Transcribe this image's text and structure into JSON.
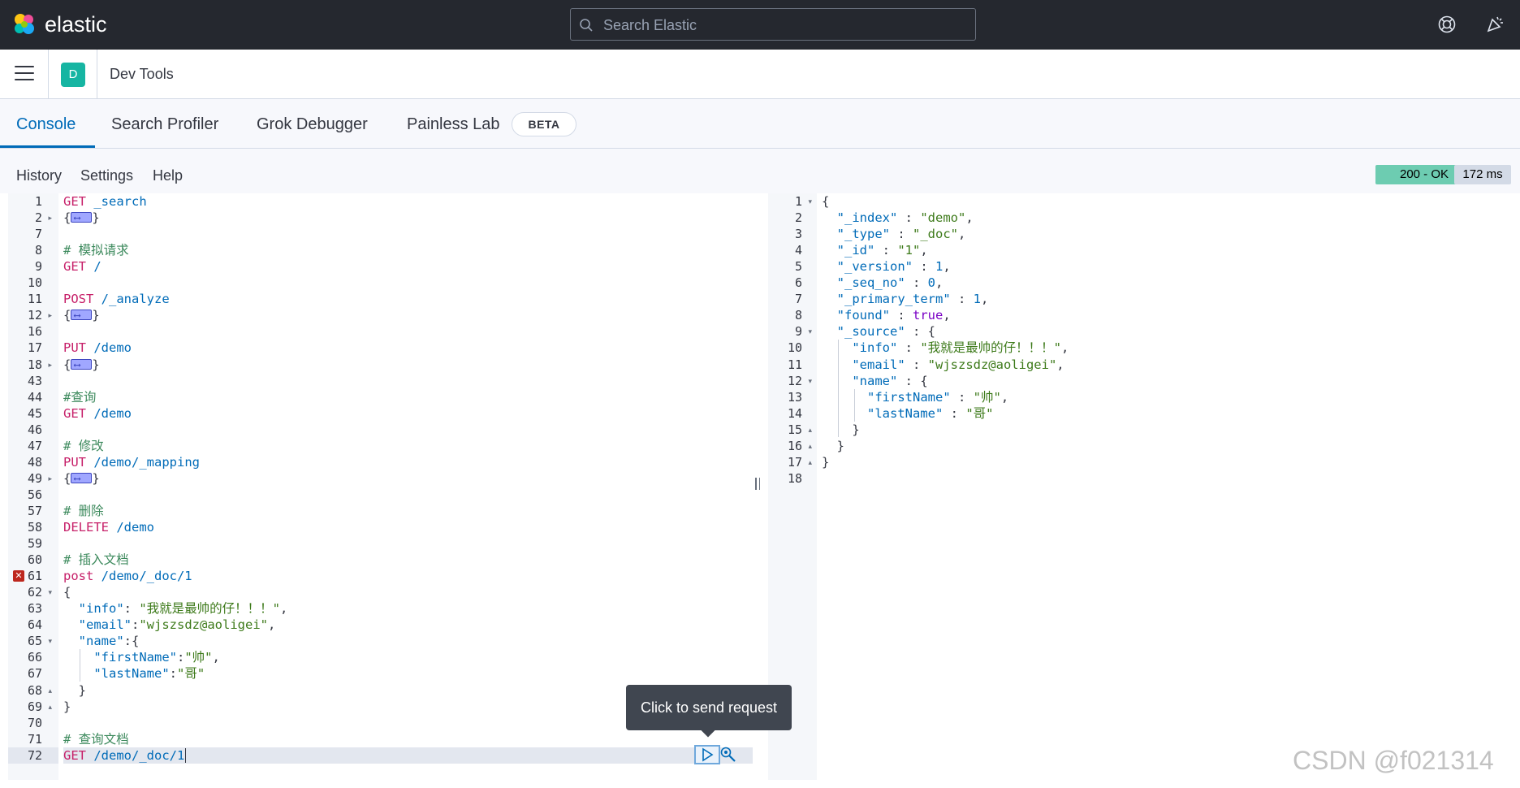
{
  "header": {
    "brand": "elastic",
    "search_placeholder": "Search Elastic"
  },
  "breadcrumb": {
    "space_initial": "D",
    "title": "Dev Tools"
  },
  "tabs": [
    {
      "label": "Console",
      "active": true
    },
    {
      "label": "Search Profiler",
      "active": false
    },
    {
      "label": "Grok Debugger",
      "active": false
    },
    {
      "label": "Painless Lab",
      "active": false
    }
  ],
  "beta_badge": "BETA",
  "toolbar": {
    "history": "History",
    "settings": "Settings",
    "help": "Help",
    "status": "200 - OK",
    "duration": "172 ms"
  },
  "request_editor": {
    "lines": [
      {
        "n": "1",
        "segments": [
          [
            "m",
            "GET"
          ],
          [
            "u",
            " _search"
          ]
        ]
      },
      {
        "n": "2",
        "fold": "closed",
        "segments": [
          [
            "p",
            "{"
          ],
          [
            "w",
            ""
          ],
          [
            "p",
            "}"
          ]
        ]
      },
      {
        "n": "7",
        "segments": []
      },
      {
        "n": "8",
        "segments": [
          [
            "c",
            "# 模拟请求"
          ]
        ]
      },
      {
        "n": "9",
        "segments": [
          [
            "m",
            "GET"
          ],
          [
            "u",
            " /"
          ]
        ]
      },
      {
        "n": "10",
        "segments": []
      },
      {
        "n": "11",
        "segments": [
          [
            "m",
            "POST"
          ],
          [
            "u",
            " /_analyze"
          ]
        ]
      },
      {
        "n": "12",
        "fold": "closed",
        "segments": [
          [
            "p",
            "{"
          ],
          [
            "w",
            ""
          ],
          [
            "p",
            "}"
          ]
        ]
      },
      {
        "n": "16",
        "segments": []
      },
      {
        "n": "17",
        "segments": [
          [
            "m",
            "PUT"
          ],
          [
            "u",
            " /demo"
          ]
        ]
      },
      {
        "n": "18",
        "fold": "closed",
        "segments": [
          [
            "p",
            "{"
          ],
          [
            "w",
            ""
          ],
          [
            "p",
            "}"
          ]
        ]
      },
      {
        "n": "43",
        "segments": []
      },
      {
        "n": "44",
        "segments": [
          [
            "c",
            "#查询"
          ]
        ]
      },
      {
        "n": "45",
        "segments": [
          [
            "m",
            "GET"
          ],
          [
            "u",
            " /demo"
          ]
        ]
      },
      {
        "n": "46",
        "segments": []
      },
      {
        "n": "47",
        "segments": [
          [
            "c",
            "# 修改"
          ]
        ]
      },
      {
        "n": "48",
        "segments": [
          [
            "m",
            "PUT"
          ],
          [
            "u",
            " /demo/_mapping"
          ]
        ]
      },
      {
        "n": "49",
        "fold": "closed",
        "segments": [
          [
            "p",
            "{"
          ],
          [
            "w",
            ""
          ],
          [
            "p",
            "}"
          ]
        ]
      },
      {
        "n": "56",
        "segments": []
      },
      {
        "n": "57",
        "segments": [
          [
            "c",
            "# 删除"
          ]
        ]
      },
      {
        "n": "58",
        "segments": [
          [
            "m",
            "DELETE"
          ],
          [
            "u",
            " /demo"
          ]
        ]
      },
      {
        "n": "59",
        "segments": []
      },
      {
        "n": "60",
        "segments": [
          [
            "c",
            "# 插入文档"
          ]
        ]
      },
      {
        "n": "61",
        "error": true,
        "segments": [
          [
            "m",
            "post"
          ],
          [
            "u",
            " /demo/_doc/1"
          ]
        ]
      },
      {
        "n": "62",
        "fold": "open",
        "segments": [
          [
            "p",
            "{"
          ]
        ]
      },
      {
        "n": "63",
        "segments": [
          [
            "p",
            "  "
          ],
          [
            "k",
            "\"info\""
          ],
          [
            "p",
            ": "
          ],
          [
            "s",
            "\"我就是最帅的仔！！！\""
          ],
          [
            "p",
            ","
          ]
        ]
      },
      {
        "n": "64",
        "segments": [
          [
            "p",
            "  "
          ],
          [
            "k",
            "\"email\""
          ],
          [
            "p",
            ":"
          ],
          [
            "s",
            "\"wjszsdz@aoligei\""
          ],
          [
            "p",
            ","
          ]
        ]
      },
      {
        "n": "65",
        "fold": "open",
        "segments": [
          [
            "p",
            "  "
          ],
          [
            "k",
            "\"name\""
          ],
          [
            "p",
            ":{"
          ]
        ]
      },
      {
        "n": "66",
        "segments": [
          [
            "p",
            "    "
          ],
          [
            "k",
            "\"firstName\""
          ],
          [
            "p",
            ":"
          ],
          [
            "s",
            "\"帅\""
          ],
          [
            "p",
            ","
          ]
        ]
      },
      {
        "n": "67",
        "segments": [
          [
            "p",
            "    "
          ],
          [
            "k",
            "\"lastName\""
          ],
          [
            "p",
            ":"
          ],
          [
            "s",
            "\"哥\""
          ]
        ]
      },
      {
        "n": "68",
        "fold": "end",
        "segments": [
          [
            "p",
            "  }"
          ]
        ]
      },
      {
        "n": "69",
        "fold": "end",
        "segments": [
          [
            "p",
            "}"
          ]
        ]
      },
      {
        "n": "70",
        "segments": []
      },
      {
        "n": "71",
        "segments": [
          [
            "c",
            "# 查询文档"
          ]
        ]
      },
      {
        "n": "72",
        "active": true,
        "segments": [
          [
            "m",
            "GET"
          ],
          [
            "u",
            " /demo/_doc/1"
          ]
        ]
      }
    ]
  },
  "response_editor": {
    "lines": [
      {
        "n": "1",
        "fold": "open",
        "segments": [
          [
            "p",
            "{"
          ]
        ]
      },
      {
        "n": "2",
        "segments": [
          [
            "p",
            "  "
          ],
          [
            "k",
            "\"_index\""
          ],
          [
            "p",
            " : "
          ],
          [
            "s",
            "\"demo\""
          ],
          [
            "p",
            ","
          ]
        ]
      },
      {
        "n": "3",
        "segments": [
          [
            "p",
            "  "
          ],
          [
            "k",
            "\"_type\""
          ],
          [
            "p",
            " : "
          ],
          [
            "s",
            "\"_doc\""
          ],
          [
            "p",
            ","
          ]
        ]
      },
      {
        "n": "4",
        "segments": [
          [
            "p",
            "  "
          ],
          [
            "k",
            "\"_id\""
          ],
          [
            "p",
            " : "
          ],
          [
            "s",
            "\"1\""
          ],
          [
            "p",
            ","
          ]
        ]
      },
      {
        "n": "5",
        "segments": [
          [
            "p",
            "  "
          ],
          [
            "k",
            "\"_version\""
          ],
          [
            "p",
            " : "
          ],
          [
            "n",
            "1"
          ],
          [
            "p",
            ","
          ]
        ]
      },
      {
        "n": "6",
        "segments": [
          [
            "p",
            "  "
          ],
          [
            "k",
            "\"_seq_no\""
          ],
          [
            "p",
            " : "
          ],
          [
            "n",
            "0"
          ],
          [
            "p",
            ","
          ]
        ]
      },
      {
        "n": "7",
        "segments": [
          [
            "p",
            "  "
          ],
          [
            "k",
            "\"_primary_term\""
          ],
          [
            "p",
            " : "
          ],
          [
            "n",
            "1"
          ],
          [
            "p",
            ","
          ]
        ]
      },
      {
        "n": "8",
        "segments": [
          [
            "p",
            "  "
          ],
          [
            "k",
            "\"found\""
          ],
          [
            "p",
            " : "
          ],
          [
            "b",
            "true"
          ],
          [
            "p",
            ","
          ]
        ]
      },
      {
        "n": "9",
        "fold": "open",
        "segments": [
          [
            "p",
            "  "
          ],
          [
            "k",
            "\"_source\""
          ],
          [
            "p",
            " : {"
          ]
        ]
      },
      {
        "n": "10",
        "segments": [
          [
            "p",
            "    "
          ],
          [
            "k",
            "\"info\""
          ],
          [
            "p",
            " : "
          ],
          [
            "s",
            "\"我就是最帅的仔！！！\""
          ],
          [
            "p",
            ","
          ]
        ]
      },
      {
        "n": "11",
        "segments": [
          [
            "p",
            "    "
          ],
          [
            "k",
            "\"email\""
          ],
          [
            "p",
            " : "
          ],
          [
            "s",
            "\"wjszsdz@aoligei\""
          ],
          [
            "p",
            ","
          ]
        ]
      },
      {
        "n": "12",
        "fold": "open",
        "segments": [
          [
            "p",
            "    "
          ],
          [
            "k",
            "\"name\""
          ],
          [
            "p",
            " : {"
          ]
        ]
      },
      {
        "n": "13",
        "segments": [
          [
            "p",
            "      "
          ],
          [
            "k",
            "\"firstName\""
          ],
          [
            "p",
            " : "
          ],
          [
            "s",
            "\"帅\""
          ],
          [
            "p",
            ","
          ]
        ]
      },
      {
        "n": "14",
        "segments": [
          [
            "p",
            "      "
          ],
          [
            "k",
            "\"lastName\""
          ],
          [
            "p",
            " : "
          ],
          [
            "s",
            "\"哥\""
          ]
        ]
      },
      {
        "n": "15",
        "fold": "end",
        "segments": [
          [
            "p",
            "    }"
          ]
        ]
      },
      {
        "n": "16",
        "fold": "end",
        "segments": [
          [
            "p",
            "  }"
          ]
        ]
      },
      {
        "n": "17",
        "fold": "end",
        "segments": [
          [
            "p",
            "}"
          ]
        ]
      },
      {
        "n": "18",
        "segments": []
      }
    ]
  },
  "tooltip": "Click to send request",
  "watermark": "CSDN @f021314",
  "colors": {
    "header_bg": "#25282f",
    "accent": "#006bb8",
    "status_ok": "#6dccb1",
    "method": "#c61e68",
    "string": "#3d7a1a",
    "comment": "#3d8a5d"
  }
}
